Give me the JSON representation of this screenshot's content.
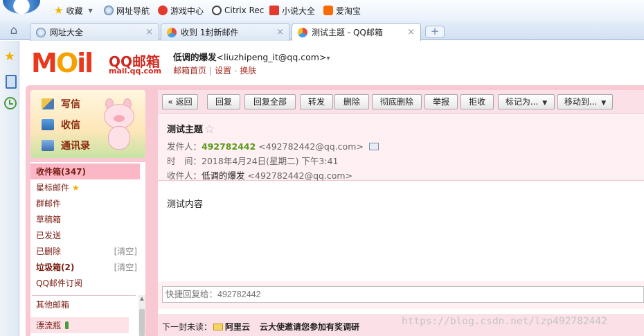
{
  "browser": {
    "bookmarks": [
      {
        "label": "收藏",
        "icon": "star-icon"
      },
      {
        "label": "网址导航",
        "icon": "globe-icon"
      },
      {
        "label": "游戏中心",
        "icon": "game-icon"
      },
      {
        "label": "Citrix Rec",
        "icon": "citrix-icon"
      },
      {
        "label": "小说大全",
        "icon": "book-icon"
      },
      {
        "label": "爱淘宝",
        "icon": "taobao-icon"
      }
    ],
    "tabs": [
      {
        "label": "网址大全",
        "icon": "globe-icon",
        "close": "×"
      },
      {
        "label": "收到 1封新邮件",
        "icon": "qq-icon",
        "close": "×"
      },
      {
        "label": "测试主题 - QQ邮箱",
        "icon": "qq-icon",
        "close": "×"
      }
    ],
    "new_tab_label": "+",
    "side_strip": [
      "star-icon",
      "device-icon",
      "clock-icon"
    ]
  },
  "header": {
    "logo_text": {
      "m": "M",
      "o": "O",
      "rest": "il"
    },
    "logo_qq": "QQ邮箱",
    "logo_domain": "mail.qq.com",
    "user_name": "低调的爆发",
    "user_email": "<liuzhipeng_it@qq.com>",
    "user_caret": "▾",
    "links": [
      "邮箱首页",
      "设置",
      "换肤"
    ],
    "sep1": "|",
    "sep2": "-"
  },
  "quick_actions": [
    {
      "label": "写信",
      "icon": "write-icon"
    },
    {
      "label": "收信",
      "icon": "inbox-icon"
    },
    {
      "label": "通讯录",
      "icon": "contacts-icon"
    }
  ],
  "folders": [
    {
      "label": "收件箱(347)",
      "selected": true
    },
    {
      "label": "星标邮件"
    },
    {
      "label": "群邮件"
    },
    {
      "label": "草稿箱"
    },
    {
      "label": "已发送"
    },
    {
      "label": "已删除",
      "action": "[清空]"
    },
    {
      "label": "垃圾箱(2)",
      "action": "[清空]"
    },
    {
      "label": "QQ邮件订阅"
    },
    {
      "label": "其他邮箱"
    },
    {
      "label": "漂流瓶"
    }
  ],
  "toolbar": {
    "back": "« 返回",
    "reply": "回复",
    "reply_all": "回复全部",
    "forward": "转发",
    "delete": "删除",
    "perm_delete": "彻底删除",
    "report": "举报",
    "reject": "拒收",
    "mark_as": "标记为...",
    "move_to": "移动到...",
    "dropdown": "▼"
  },
  "message": {
    "subject": "测试主题",
    "star": "☆",
    "from_label": "发件人：",
    "from_name": "492782442",
    "from_addr": "<492782442@qq.com>",
    "time_label": "时　间：",
    "time_value": "2018年4月24日(星期二) 下午3:41",
    "to_label": "收件人：",
    "to_name": "低调的爆发",
    "to_addr": "<492782442@qq.com>",
    "body": "测试内容"
  },
  "quick_reply": {
    "placeholder": "快捷回复给：492782442"
  },
  "next_unread": {
    "label": "下一封未读：",
    "from": "阿里云",
    "subject": "云大使邀请您参加有奖调研"
  },
  "watermark": "https://blog.csdn.net/lzp492782442"
}
